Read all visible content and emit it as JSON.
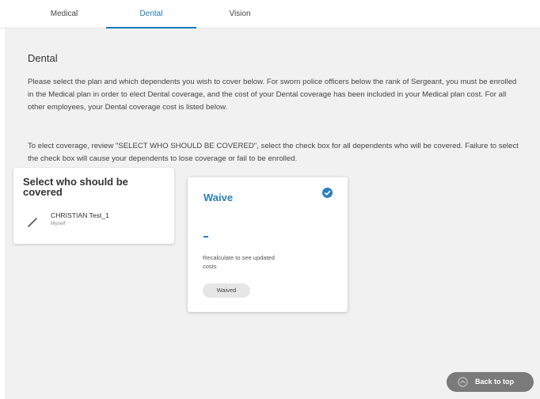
{
  "tabs": [
    {
      "label": "Medical"
    },
    {
      "label": "Dental"
    },
    {
      "label": "Vision"
    }
  ],
  "section": {
    "heading": "Dental",
    "paragraph1": "Please select the plan and which dependents you wish to cover below. For sworn police officers below the rank of Sergeant, you must be enrolled in the Medical plan in order to elect Dental coverage, and the cost of your Dental coverage has been included in your Medical plan cost. For all other employees, your Dental coverage cost is listed below.",
    "paragraph2": "To elect coverage, review \"SELECT WHO SHOULD BE COVERED\", select the check box for all dependents who will be covered. Failure to select the check box will cause your dependents to lose coverage or fail to be enrolled."
  },
  "covered": {
    "title": "Select who should be covered",
    "dependents": [
      {
        "name": "CHRISTIAN Test_1",
        "relation": "Myself"
      }
    ]
  },
  "plan_card": {
    "title": "Waive",
    "cost": "-",
    "recalc_note": "Recalculate to see updated costs",
    "status_badge": "Waived"
  },
  "back_to_top": {
    "label": "Back to top"
  },
  "colors": {
    "accent": "#2a7fc0",
    "background": "#f1f1f1",
    "button": "#7a7a7a"
  }
}
